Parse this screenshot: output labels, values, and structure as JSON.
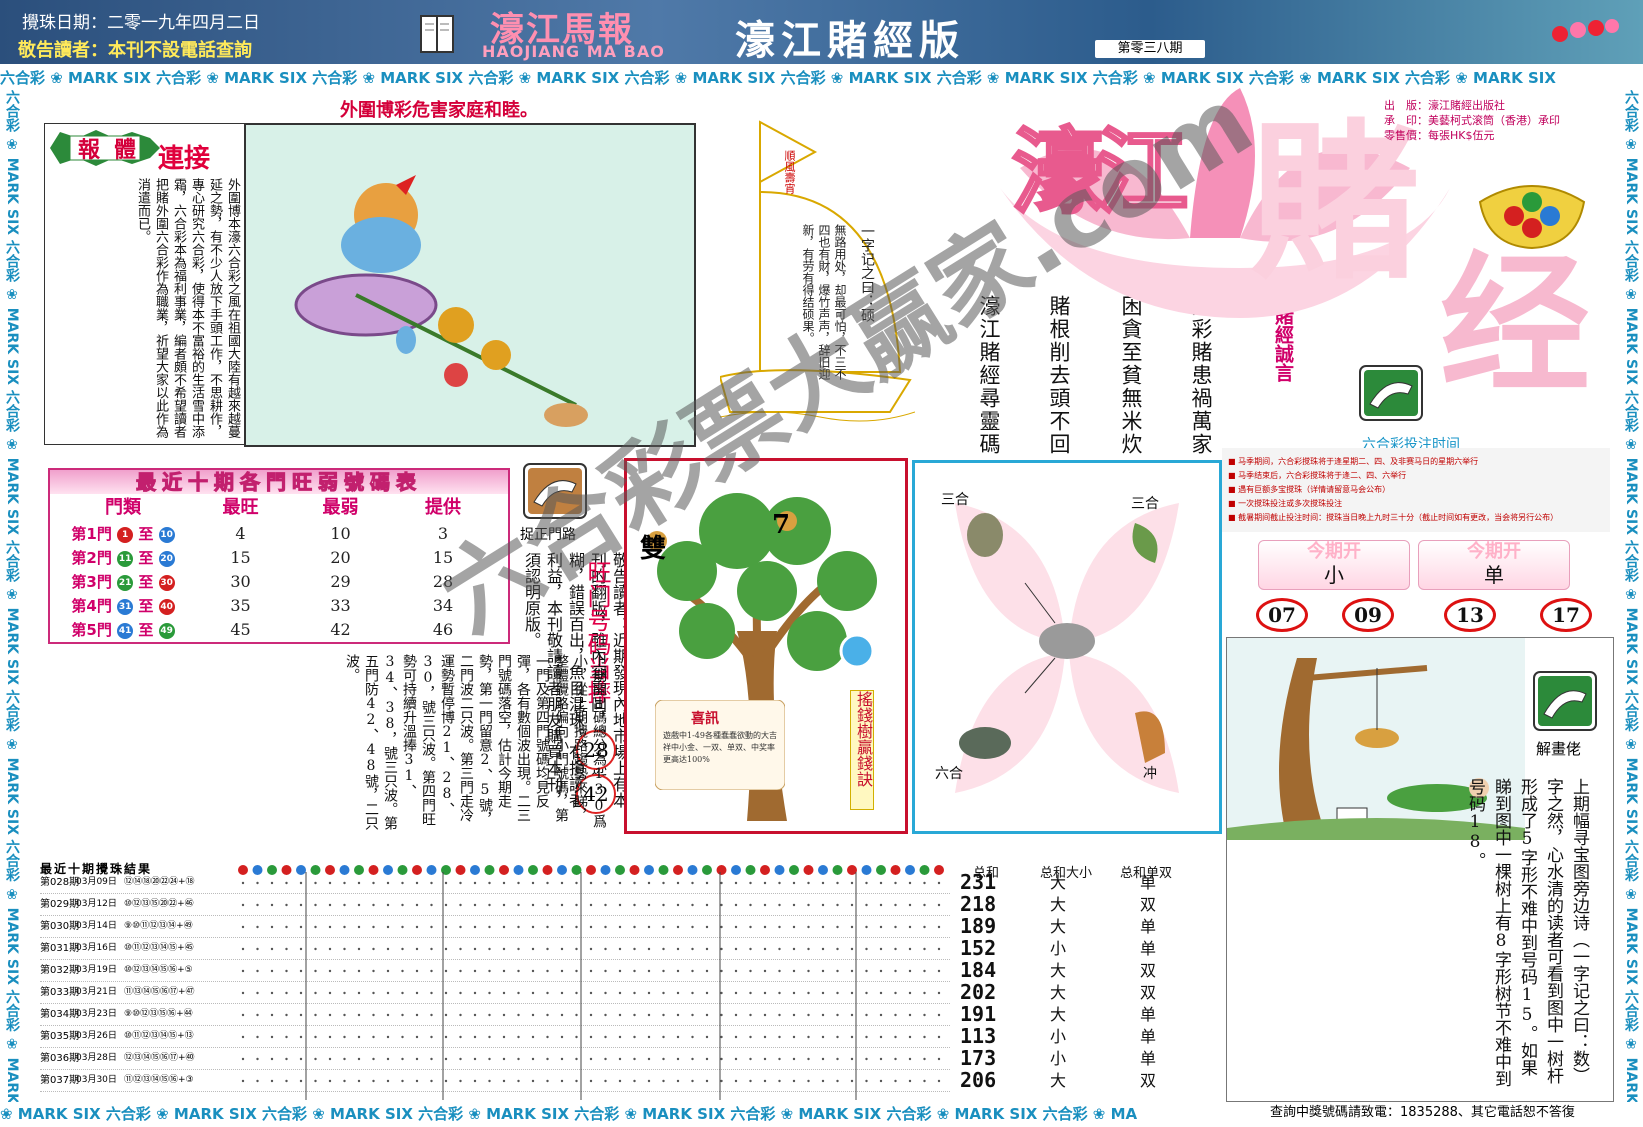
{
  "header": {
    "draw_date": "攪珠日期：二零一九年四月二日",
    "notice": "敬告讀者：本刊不設電話查詢",
    "logo_cn": "濠江馬報",
    "logo_en": "HAOJIANG MA BAO",
    "edition_title": "濠江賭經版",
    "issue_no": "第零三八期"
  },
  "strip_text": "六合彩 ❀ MARK SIX 六合彩 ❀ MARK SIX 六合彩 ❀ MARK SIX 六合彩 ❀ MARK SIX 六合彩 ❀ MARK SIX 六合彩 ❀ MARK SIX 六合彩 ❀ MARK SIX 六合彩 ❀ MARK SIX 六合彩 ❀ MARK SIX 六合彩 ❀ MARK SIX",
  "strip_bottom_text": "❀ MARK SIX 六合彩 ❀ MARK SIX 六合彩 ❀ MARK SIX 六合彩 ❀ MARK SIX 六合彩 ❀ MARK SIX 六合彩 ❀ MARK SIX 六合彩 ❀ MARK SIX 六合彩 ❀ MA",
  "article": {
    "slogan": "外圍博彩危害家庭和睦。",
    "badge": "報體",
    "link_label": "連接",
    "text": "外圍博本濠六合彩之風在祖國大陸有越來越蔓延之勢，有不少人放下手頭工作，不思耕作，專心研究六合彩，使得本不富裕的生活雪中添霜，六合彩本為福利事業，編者頗不希望讀者把賭外圍六合彩作為職業，祈望大家以此作為消遣而已。"
  },
  "hot_table": {
    "title": "最近十期各門旺弱號碼表",
    "headers": [
      "門類",
      "最旺",
      "最弱",
      "提供"
    ],
    "rows": [
      {
        "gate": "第1門",
        "from": "1",
        "to": "10",
        "hot": "4",
        "cold": "10",
        "offer": "3",
        "c1": "#d42020",
        "c2": "#2a7ad4"
      },
      {
        "gate": "第2門",
        "from": "11",
        "to": "20",
        "hot": "15",
        "cold": "20",
        "offer": "15",
        "c1": "#2a9a3a",
        "c2": "#2a7ad4"
      },
      {
        "gate": "第3門",
        "from": "21",
        "to": "30",
        "hot": "30",
        "cold": "29",
        "offer": "28",
        "c1": "#2a9a3a",
        "c2": "#d42020"
      },
      {
        "gate": "第4門",
        "from": "31",
        "to": "40",
        "hot": "35",
        "cold": "33",
        "offer": "34",
        "c1": "#2a7ad4",
        "c2": "#d42020"
      },
      {
        "gate": "第5門",
        "from": "41",
        "to": "49",
        "hot": "45",
        "cold": "42",
        "offer": "46",
        "c1": "#2a7ad4",
        "c2": "#2a9a3a"
      }
    ],
    "conn": "至"
  },
  "promo": {
    "icon_label": "捉正門路",
    "hot_gate_title": "旺门号码当摔",
    "hot_numbers": [
      "28",
      "42"
    ],
    "ftf_notice": "敬告讀者：近期發現內地市場上有本刊的翻版，雖內容雷同，但字迹模糊，錯誤百出，魚目混珠。有損讀者利益，本刊敬請讀者朋友購買本刊，須認明原版。",
    "analysis": "上期開出碼總分為130爲小，從上期攪路趨勢來睇，整體攪路偏向小門號碼，第一門及第四門號碼均見反彈，各有數個波出現。二三門號碼落空，估計今期走勢，第一門留意2、5號，二門波二只波。第三門走冷運勢暫停博21、28、30，號三只波。第四門旺勢可持續升溫捧31、34、38，號三只波。第五門防42、48號，二只波。"
  },
  "sail": {
    "flag": "順風壽宵",
    "title": "一字记之曰：硕",
    "verse": "無路用处，却最可怕，不三不四也有財，爆竹声声，辞旧迎新，有劳有得结硕果。"
  },
  "mottos": [
    "六彩賭患禍萬家",
    "困貪至貧無米炊",
    "賭根削去頭不回",
    "濠江賭經尋靈碼"
  ],
  "motto_label": "賭經誠言",
  "lotus": {
    "big1": "濠江",
    "big2": "賭",
    "big3": "经"
  },
  "publisher": [
    "出　版：濠江賭經出版社",
    "承　印：美藝柯式滚筒（香港）承印",
    "零售價：每張HK$伍元"
  ],
  "time_label": "六合彩投注时间",
  "schedule": [
    "■ 马季期间，六合彩搅珠将于逢星期二、四、及非赛马日的星期六举行",
    "■ 马季结束后，六合彩搅珠将于逢二、四、六举行",
    "■ 遇有巨额多宝搅珠（详情请留意马会公布）",
    "■ 一次搅珠投注或多次搅珠投注",
    "■ 截暑期间截止投注时间：搅珠当日晚上九时三十分（截止时间如有更改，当会将另行公布）"
  ],
  "open": {
    "label": "今期开",
    "values": [
      "小",
      "单"
    ],
    "numbers": [
      "07",
      "09",
      "13",
      "17"
    ]
  },
  "tree": {
    "char_left": "雙",
    "char_right": "7",
    "badge": "搖錢樹贏錢訣",
    "sign_title": "喜訊",
    "sign_text": "遊戲中1-49各種蠢蠢欲動的大吉祥中小金、一双、单双、中奖率更高达100%"
  },
  "zodiac": {
    "labels": [
      "三合",
      "三合",
      "六合",
      "冲"
    ]
  },
  "riddle": {
    "icon_label": "解畫佬",
    "text": "上期幅寻宝图旁边诗（一字记之曰：数）字之然，心水清的读者可看到图中一树杆形成了5字形不难中到号码15。如果睇到图中一棵树上有8字形树节不难中到号码18。"
  },
  "results": {
    "title": "最近十期攪珠結果",
    "sum_header": "总和",
    "bs_header": "总和大小",
    "oe_header": "总和单双",
    "rows": [
      {
        "issue": "第028期",
        "date": "03月09日",
        "nums": "⑫⑭⑱⑳㉒㉔+⑱",
        "sum": "231",
        "bs": "大",
        "oe": "单"
      },
      {
        "issue": "第029期",
        "date": "03月12日",
        "nums": "⑩⑫⑬⑮⑳㉒+㊻",
        "sum": "218",
        "bs": "大",
        "oe": "双"
      },
      {
        "issue": "第030期",
        "date": "03月14日",
        "nums": "⑨⑩⑪⑫⑬⑭+㊾",
        "sum": "189",
        "bs": "大",
        "oe": "单"
      },
      {
        "issue": "第031期",
        "date": "03月16日",
        "nums": "⑩⑪⑫⑬⑭⑮+㊺",
        "sum": "152",
        "bs": "小",
        "oe": "单"
      },
      {
        "issue": "第032期",
        "date": "03月19日",
        "nums": "⑩⑫⑬⑭⑮⑯+⑤",
        "sum": "184",
        "bs": "大",
        "oe": "双"
      },
      {
        "issue": "第033期",
        "date": "03月21日",
        "nums": "⑪⑬⑭⑮⑯⑰+㊼",
        "sum": "202",
        "bs": "大",
        "oe": "双"
      },
      {
        "issue": "第034期",
        "date": "03月23日",
        "nums": "⑨⑩⑫⑬⑮⑯+㊹",
        "sum": "191",
        "bs": "大",
        "oe": "单"
      },
      {
        "issue": "第035期",
        "date": "03月26日",
        "nums": "⑩⑪⑫⑬⑭⑮+⑬",
        "sum": "113",
        "bs": "小",
        "oe": "单"
      },
      {
        "issue": "第036期",
        "date": "03月28日",
        "nums": "⑫⑬⑭⑮⑯⑰+㊵",
        "sum": "173",
        "bs": "小",
        "oe": "单"
      },
      {
        "issue": "第037期",
        "date": "03月30日",
        "nums": "⑪⑫⑬⑭⑮⑯+③",
        "sum": "206",
        "bs": "大",
        "oe": "双"
      }
    ]
  },
  "hotline": "查詢中獎號碼請致電：1835288、其它電話恕不答復",
  "watermark": "六合彩票大赢家.com"
}
